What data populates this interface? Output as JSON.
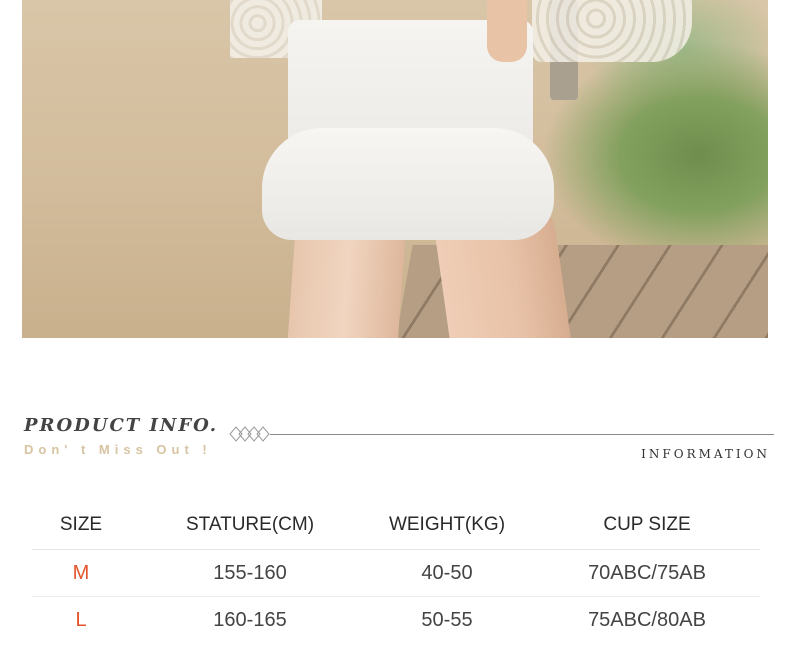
{
  "product_info": {
    "title": "PRODUCT   INFO.",
    "subtitle": "Don' t  Miss  Out !",
    "section_label": "INFORMATION"
  },
  "size_table": {
    "headers": [
      "SIZE",
      "STATURE(CM)",
      "WEIGHT(KG)",
      "CUP SIZE"
    ],
    "rows": [
      [
        "M",
        "155-160",
        "40-50",
        "70ABC/75AB"
      ],
      [
        "L",
        "160-165",
        "50-55",
        "75ABC/80AB"
      ]
    ]
  },
  "colors": {
    "size_accent": "#e3542a",
    "subtitle_gold": "#d6c4a2",
    "divider_gray": "#8a8a8a"
  }
}
